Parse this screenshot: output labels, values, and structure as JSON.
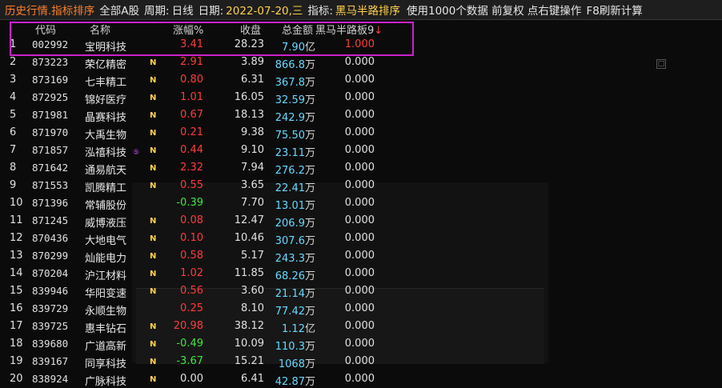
{
  "titlebar": {
    "mode": "历史行情.指标排序",
    "scope": "全部A股",
    "period_label": "周期:",
    "period_value": "日线",
    "date_label": "日期:",
    "date_value": "2022-07-20,三",
    "indicator_label": "指标:",
    "indicator_value": "黑马半路排序",
    "info": "使用1000个数据 前复权 点右键操作",
    "refresh": "F8刷新计算"
  },
  "columns": {
    "code": "代码",
    "name": "名称",
    "change_pct": "涨幅%",
    "close": "收盘",
    "amount": "总金额",
    "indicator": "黑马半路板9",
    "sort_arrow": "↓"
  },
  "rows": [
    {
      "idx": "1",
      "code": "002992",
      "name": "宝明科技",
      "badge": "",
      "change": "3.41",
      "dir": "up",
      "close": "28.23",
      "amount": "7.90",
      "unit": "亿",
      "ind": "1.000"
    },
    {
      "idx": "2",
      "code": "873223",
      "name": "荣亿精密",
      "badge": "N",
      "change": "2.91",
      "dir": "up",
      "close": "3.89",
      "amount": "866.8",
      "unit": "万",
      "ind": "0.000"
    },
    {
      "idx": "3",
      "code": "873169",
      "name": "七丰精工",
      "badge": "N",
      "change": "0.80",
      "dir": "up",
      "close": "6.31",
      "amount": "367.8",
      "unit": "万",
      "ind": "0.000"
    },
    {
      "idx": "4",
      "code": "872925",
      "name": "锦好医疗",
      "badge": "N",
      "change": "1.01",
      "dir": "up",
      "close": "16.05",
      "amount": "32.59",
      "unit": "万",
      "ind": "0.000"
    },
    {
      "idx": "5",
      "code": "871981",
      "name": "晶赛科技",
      "badge": "N",
      "change": "0.67",
      "dir": "up",
      "close": "18.13",
      "amount": "242.9",
      "unit": "万",
      "ind": "0.000"
    },
    {
      "idx": "6",
      "code": "871970",
      "name": "大禹生物",
      "badge": "N",
      "change": "0.21",
      "dir": "up",
      "close": "9.38",
      "amount": "75.50",
      "unit": "万",
      "ind": "0.000"
    },
    {
      "idx": "7",
      "code": "871857",
      "name": "泓禧科技",
      "badge": "N",
      "change": "0.44",
      "dir": "up",
      "close": "9.10",
      "amount": "23.11",
      "unit": "万",
      "ind": "0.000"
    },
    {
      "idx": "8",
      "code": "871642",
      "name": "通易航天",
      "badge": "N",
      "change": "2.32",
      "dir": "up",
      "close": "7.94",
      "amount": "276.2",
      "unit": "万",
      "ind": "0.000"
    },
    {
      "idx": "9",
      "code": "871553",
      "name": "凯腾精工",
      "badge": "N",
      "change": "0.55",
      "dir": "up",
      "close": "3.65",
      "amount": "22.41",
      "unit": "万",
      "ind": "0.000"
    },
    {
      "idx": "10",
      "code": "871396",
      "name": "常辅股份",
      "badge": "",
      "change": "-0.39",
      "dir": "down",
      "close": "7.70",
      "amount": "13.01",
      "unit": "万",
      "ind": "0.000"
    },
    {
      "idx": "11",
      "code": "871245",
      "name": "威博液压",
      "badge": "N",
      "change": "0.08",
      "dir": "up",
      "close": "12.47",
      "amount": "206.9",
      "unit": "万",
      "ind": "0.000"
    },
    {
      "idx": "12",
      "code": "870436",
      "name": "大地电气",
      "badge": "N",
      "change": "0.10",
      "dir": "up",
      "close": "10.46",
      "amount": "307.6",
      "unit": "万",
      "ind": "0.000"
    },
    {
      "idx": "13",
      "code": "870299",
      "name": "灿能电力",
      "badge": "N",
      "change": "0.58",
      "dir": "up",
      "close": "5.17",
      "amount": "243.3",
      "unit": "万",
      "ind": "0.000"
    },
    {
      "idx": "14",
      "code": "870204",
      "name": "沪江材料",
      "badge": "N",
      "change": "1.02",
      "dir": "up",
      "close": "11.85",
      "amount": "68.26",
      "unit": "万",
      "ind": "0.000"
    },
    {
      "idx": "15",
      "code": "839946",
      "name": "华阳变速",
      "badge": "N",
      "change": "0.56",
      "dir": "up",
      "close": "3.60",
      "amount": "21.14",
      "unit": "万",
      "ind": "0.000"
    },
    {
      "idx": "16",
      "code": "839729",
      "name": "永顺生物",
      "badge": "",
      "change": "0.25",
      "dir": "up",
      "close": "8.10",
      "amount": "77.42",
      "unit": "万",
      "ind": "0.000"
    },
    {
      "idx": "17",
      "code": "839725",
      "name": "惠丰钻石",
      "badge": "N",
      "change": "20.98",
      "dir": "up",
      "close": "38.12",
      "amount": "1.12",
      "unit": "亿",
      "ind": "0.000"
    },
    {
      "idx": "18",
      "code": "839680",
      "name": "广道高新",
      "badge": "N",
      "change": "-0.49",
      "dir": "down",
      "close": "10.09",
      "amount": "110.3",
      "unit": "万",
      "ind": "0.000"
    },
    {
      "idx": "19",
      "code": "839167",
      "name": "同享科技",
      "badge": "N",
      "change": "-3.67",
      "dir": "down",
      "close": "15.21",
      "amount": "1068",
      "unit": "万",
      "ind": "0.000"
    },
    {
      "idx": "20",
      "code": "838924",
      "name": "广脉科技",
      "badge": "N",
      "change": "0.00",
      "dir": "flat",
      "close": "6.41",
      "amount": "42.87",
      "unit": "万",
      "ind": "0.000"
    }
  ],
  "colors": {
    "up": "#ff3b3b",
    "down": "#3ee53e",
    "highlight": "#cc22cc",
    "amount": "#66d9ff",
    "badge": "#ffd14a"
  },
  "icons": {
    "collapse": "collapse-icon",
    "special_marker": "circle-marker-icon"
  }
}
